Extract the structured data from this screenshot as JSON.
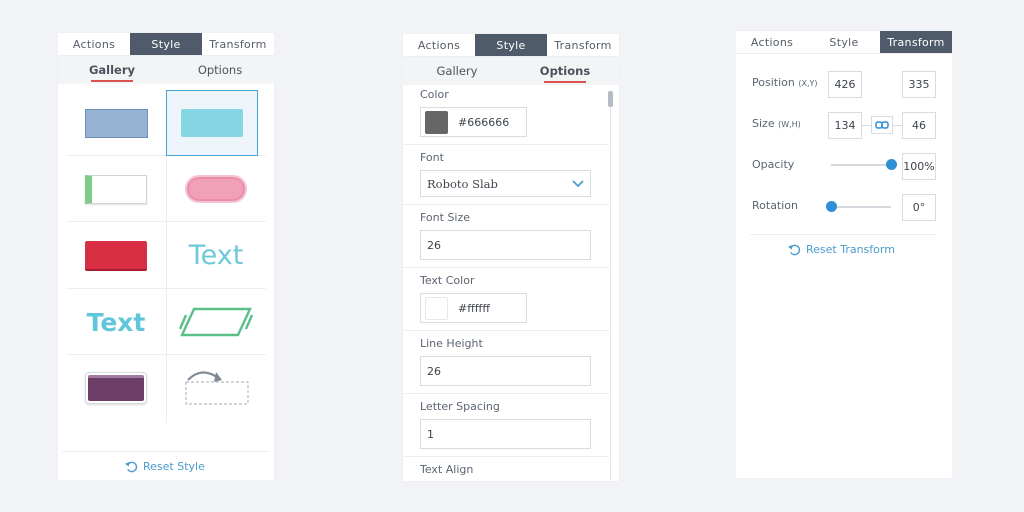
{
  "panel_style_gallery": {
    "tabs": [
      "Actions",
      "Style",
      "Transform"
    ],
    "active_tab": "Style",
    "subtabs": [
      "Gallery",
      "Options"
    ],
    "active_subtab": "Gallery",
    "gallery_items": [
      {
        "name": "blue-rect-style",
        "fill": "#96b2d3"
      },
      {
        "name": "cyan-rect-style",
        "fill": "#86d5e4"
      },
      {
        "name": "green-left-border-style",
        "fill": "#7fcb8a"
      },
      {
        "name": "pink-pill-style",
        "fill": "#f0a1b9"
      },
      {
        "name": "red-rect-style",
        "fill": "#d82f45"
      },
      {
        "name": "text-light-style",
        "text": "Text"
      },
      {
        "name": "text-bold-style",
        "text": "Text"
      },
      {
        "name": "parallelogram-style",
        "fill": "#5bbf8a"
      },
      {
        "name": "purple-card-style",
        "fill": "#6b3d67"
      },
      {
        "name": "rotate-dashed-style",
        "fill": "#8d98a4"
      }
    ],
    "reset_label": "Reset Style"
  },
  "panel_style_options": {
    "tabs": [
      "Actions",
      "Style",
      "Transform"
    ],
    "active_tab": "Style",
    "subtabs": [
      "Gallery",
      "Options"
    ],
    "active_subtab": "Options",
    "color_label": "Color",
    "color_value": "#666666",
    "color_swatch": "#666666",
    "font_label": "Font",
    "font_value": "Roboto Slab",
    "font_size_label": "Font Size",
    "font_size_value": "26",
    "text_color_label": "Text Color",
    "text_color_value": "#ffffff",
    "line_height_label": "Line Height",
    "line_height_value": "26",
    "letter_spacing_label": "Letter Spacing",
    "letter_spacing_value": "1",
    "text_align_label": "Text Align"
  },
  "panel_transform": {
    "tabs": [
      "Actions",
      "Style",
      "Transform"
    ],
    "active_tab": "Transform",
    "position_label": "Position",
    "position_unit": "(X,Y)",
    "position_x": "426",
    "position_y": "335",
    "size_label": "Size",
    "size_unit": "(W,H)",
    "size_w": "134",
    "size_h": "46",
    "opacity_label": "Opacity",
    "opacity_value": "100%",
    "opacity_fraction": 1.0,
    "rotation_label": "Rotation",
    "rotation_value": "0°",
    "rotation_fraction": 0.0,
    "reset_label": "Reset Transform"
  },
  "colors": {
    "accent": "#2f8fd6",
    "tab_active": "#4f5b6b",
    "underline": "#d9534f",
    "link": "#4a9ccc"
  }
}
